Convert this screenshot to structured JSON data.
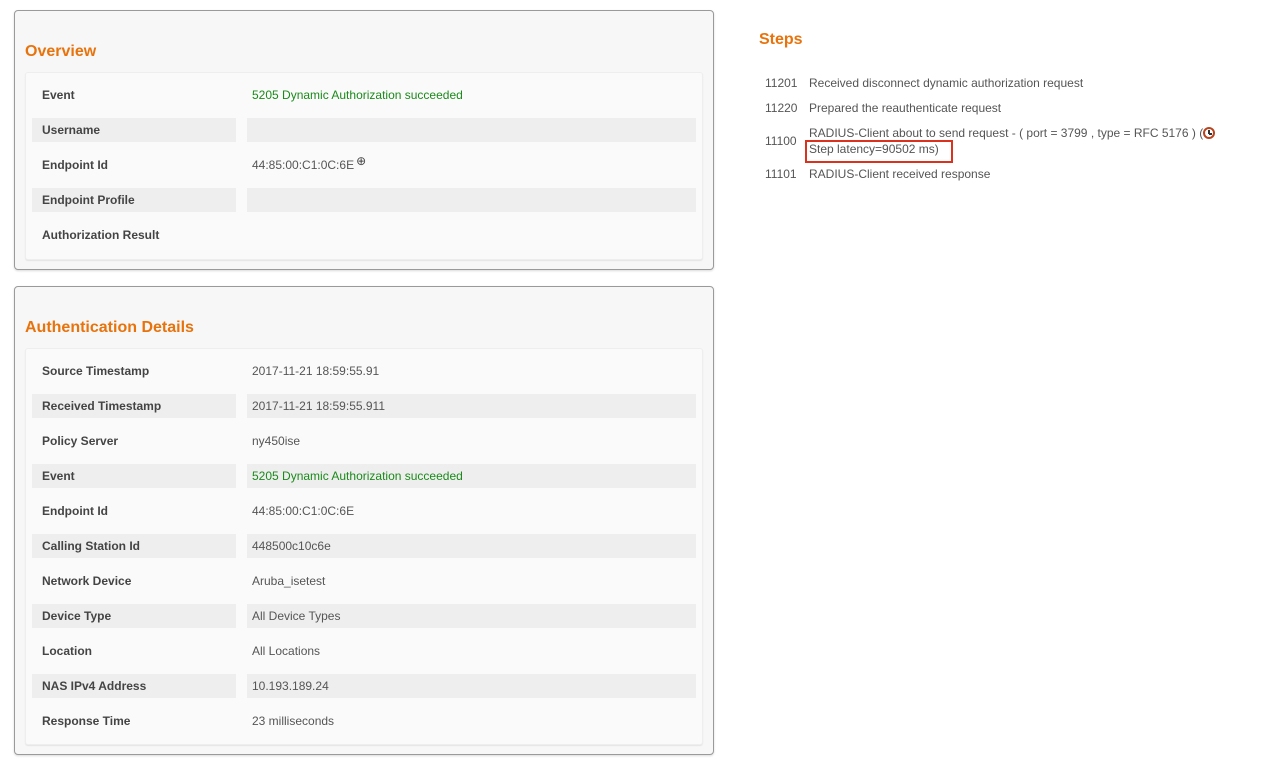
{
  "overview": {
    "title": "Overview",
    "rows": [
      {
        "label": "Event",
        "value": "5205 Dynamic Authorization succeeded"
      },
      {
        "label": "Username",
        "value": ""
      },
      {
        "label": "Endpoint Id",
        "value": "44:85:00:C1:0C:6E"
      },
      {
        "label": "Endpoint Profile",
        "value": ""
      },
      {
        "label": "Authorization Result",
        "value": ""
      }
    ],
    "endpoint_icon": "crosshair-icon"
  },
  "auth_details": {
    "title": "Authentication Details",
    "rows": [
      {
        "label": "Source Timestamp",
        "value": "2017-11-21 18:59:55.91"
      },
      {
        "label": "Received Timestamp",
        "value": "2017-11-21 18:59:55.911"
      },
      {
        "label": "Policy Server",
        "value": "ny450ise"
      },
      {
        "label": "Event",
        "value": "5205 Dynamic Authorization succeeded"
      },
      {
        "label": "Endpoint Id",
        "value": "44:85:00:C1:0C:6E"
      },
      {
        "label": "Calling Station Id",
        "value": "448500c10c6e"
      },
      {
        "label": "Network Device",
        "value": "Aruba_isetest"
      },
      {
        "label": "Device Type",
        "value": "All Device Types"
      },
      {
        "label": "Location",
        "value": "All Locations"
      },
      {
        "label": "NAS IPv4 Address",
        "value": "10.193.189.24"
      },
      {
        "label": "Response Time",
        "value": "23 milliseconds"
      }
    ]
  },
  "steps": {
    "title": "Steps",
    "items": [
      {
        "code": "11201",
        "description": "Received disconnect dynamic authorization request"
      },
      {
        "code": "11220",
        "description": "Prepared the reauthenticate request"
      },
      {
        "code": "11100",
        "description": "RADIUS-Client about to send request - ( port = 3799 , type = RFC 5176 ) (",
        "latency": "Step latency=90502 ms)"
      },
      {
        "code": "11101",
        "description": "RADIUS-Client received response"
      }
    ],
    "latency_icon": "alarm-clock-icon"
  },
  "colors": {
    "heading": "#e8730c",
    "success": "#1a8a1a",
    "highlight_box": "#d9321f"
  }
}
